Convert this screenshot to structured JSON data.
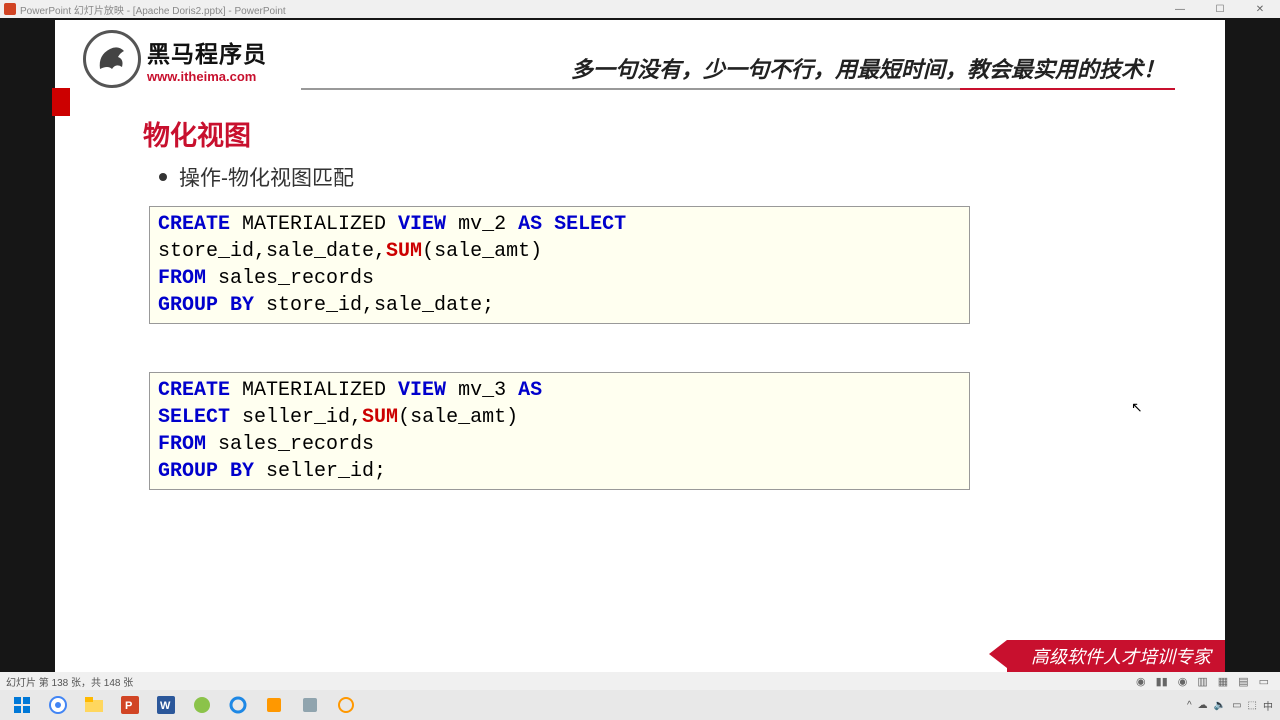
{
  "window": {
    "title": "PowerPoint 幻灯片放映 - [Apache Doris2.pptx] - PowerPoint",
    "minimize": "—",
    "maximize": "☐",
    "close": "✕"
  },
  "logo": {
    "cn": "黑马程序员",
    "url": "www.itheima.com"
  },
  "slogan": "多一句没有，少一句不行，用最短时间，教会最实用的技术！",
  "section_title": "物化视图",
  "bullet": "操作-物化视图匹配",
  "code1": {
    "kw1": "CREATE",
    "t1": " MATERIALIZED ",
    "kw2": "VIEW",
    "t2": " mv_2 ",
    "kw3": "AS",
    "t3": " ",
    "kw4": "SELECT",
    "line2a": "store_id,sale_date,",
    "fn1": "SUM",
    "line2b": "(sale_amt)",
    "kw5": "FROM",
    "line3": " sales_records",
    "kw6": "GROUP",
    "kw7": " BY",
    "line4": " store_id,sale_date;"
  },
  "code2": {
    "kw1": "CREATE",
    "t1": " MATERIALIZED ",
    "kw2": "VIEW",
    "t2": " mv_3 ",
    "kw3": "AS",
    "kw4": "SELECT",
    "line2a": " seller_id,",
    "fn1": "SUM",
    "line2b": "(sale_amt)",
    "kw5": "FROM",
    "line3": " sales_records",
    "kw6": "GROUP",
    "kw7": " BY",
    "line4": " seller_id;"
  },
  "ribbon": "高级软件人才培训专家",
  "status": "幻灯片 第 138 张，共 148 张",
  "tray_icons": [
    "^",
    "☁",
    "🔈",
    "▭",
    "⬚",
    "中"
  ]
}
